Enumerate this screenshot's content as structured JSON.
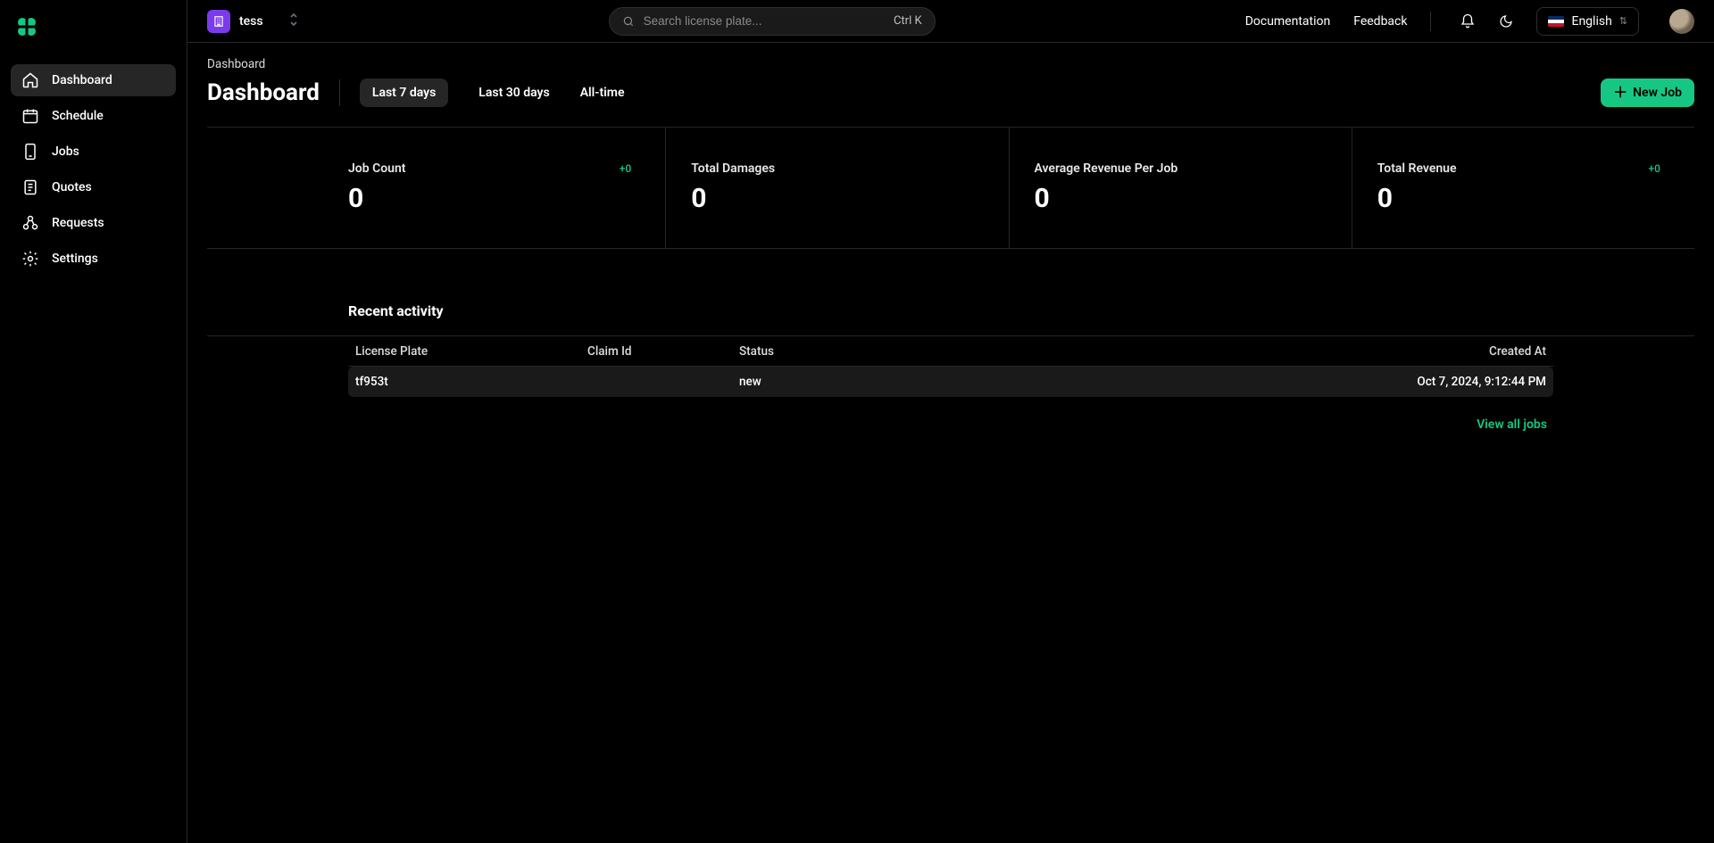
{
  "workspace": {
    "name": "tess",
    "badge_icon": "building-icon"
  },
  "search": {
    "placeholder": "Search license plate...",
    "shortcut": "Ctrl K"
  },
  "topnav": {
    "documentation": "Documentation",
    "feedback": "Feedback",
    "language_label": "English"
  },
  "sidebar": {
    "items": [
      {
        "icon": "home-icon",
        "label": "Dashboard",
        "active": true
      },
      {
        "icon": "calendar-icon",
        "label": "Schedule"
      },
      {
        "icon": "phone-icon",
        "label": "Jobs"
      },
      {
        "icon": "file-icon",
        "label": "Quotes"
      },
      {
        "icon": "requests-icon",
        "label": "Requests"
      },
      {
        "icon": "gear-icon",
        "label": "Settings"
      }
    ]
  },
  "breadcrumb": "Dashboard",
  "page_title": "Dashboard",
  "tabs": [
    "Last 7 days",
    "Last 30 days",
    "All-time"
  ],
  "active_tab_index": 0,
  "new_job_label": "New Job",
  "stats": [
    {
      "label": "Job Count",
      "value": "0",
      "delta": "+0"
    },
    {
      "label": "Total Damages",
      "value": "0",
      "delta": ""
    },
    {
      "label": "Average Revenue Per Job",
      "value": "0",
      "delta": ""
    },
    {
      "label": "Total Revenue",
      "value": "0",
      "delta": "+0"
    }
  ],
  "recent_activity": {
    "title": "Recent activity",
    "columns": [
      "License Plate",
      "Claim Id",
      "Status",
      "Created At"
    ],
    "rows": [
      {
        "license_plate": "tf953t",
        "claim_id": "",
        "status": "new",
        "created_at": "Oct 7, 2024, 9:12:44 PM"
      }
    ],
    "view_all": "View all jobs"
  },
  "colors": {
    "accent_green": "#16c784",
    "workspace_purple": "#7c3aed",
    "border": "#262626"
  }
}
